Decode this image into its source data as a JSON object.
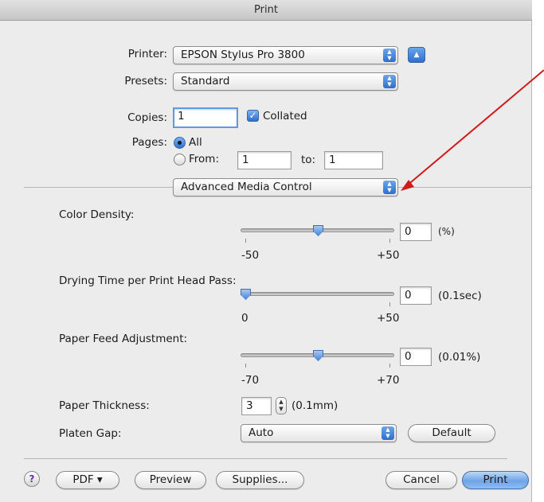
{
  "window": {
    "title": "Print"
  },
  "printer": {
    "label": "Printer:",
    "value": "EPSON Stylus Pro 3800"
  },
  "presets": {
    "label": "Presets:",
    "value": "Standard"
  },
  "copies": {
    "label": "Copies:",
    "value": "1",
    "collated_label": "Collated",
    "collated_checked": true
  },
  "pages": {
    "label": "Pages:",
    "all_label": "All",
    "from_label": "From:",
    "from_value": "1",
    "to_label": "to:",
    "to_value": "1",
    "selected": "All"
  },
  "panel_menu": {
    "value": "Advanced Media Control"
  },
  "color_density": {
    "label": "Color Density:",
    "value": "0",
    "unit": "(%)",
    "min_label": "-50",
    "max_label": "+50"
  },
  "drying_time": {
    "label": "Drying Time per Print Head Pass:",
    "value": "0",
    "unit": "(0.1sec)",
    "min_label": "0",
    "max_label": "+50"
  },
  "paper_feed": {
    "label": "Paper Feed Adjustment:",
    "value": "0",
    "unit": "(0.01%)",
    "min_label": "-70",
    "max_label": "+70"
  },
  "paper_thickness": {
    "label": "Paper Thickness:",
    "value": "3",
    "unit": "(0.1mm)"
  },
  "platen_gap": {
    "label": "Platen Gap:",
    "value": "Auto",
    "default_button": "Default"
  },
  "footer": {
    "help": "?",
    "pdf_button": "PDF ▾",
    "preview_button": "Preview",
    "supplies_button": "Supplies...",
    "cancel_button": "Cancel",
    "print_button": "Print"
  },
  "colors": {
    "accent": "#2d6fcf",
    "annotation_arrow": "#d11a1a"
  }
}
